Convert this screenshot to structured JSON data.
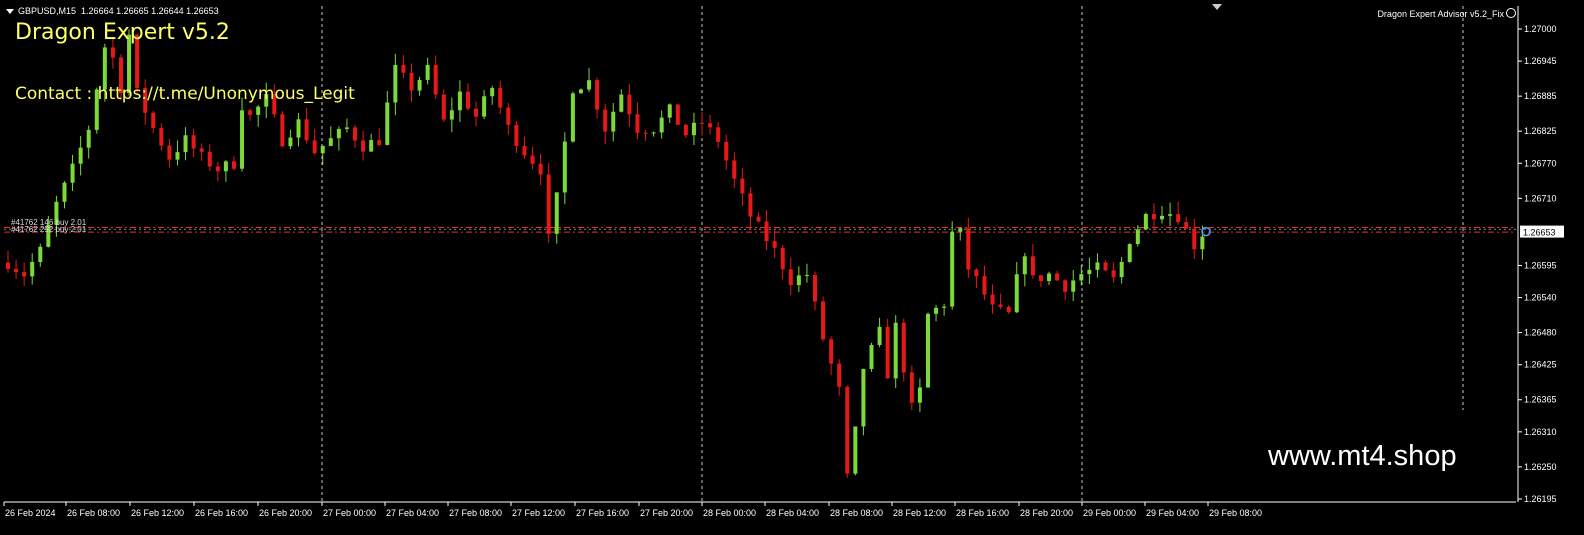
{
  "symbol_info": {
    "symbol": "GBPUSD,M15",
    "ohlc": "1.26664 1.26665 1.26644 1.26653"
  },
  "ea": {
    "title": "Dragon Expert v5.2",
    "contact": "Contact : https://t.me/Unonymous_Legit",
    "label": "Dragon Expert Advisor v5.2_Fix"
  },
  "watermark": "www.mt4.shop",
  "orders": [
    {
      "text": "#41762 146 buy 2.01"
    },
    {
      "text": "#41762 292 buy 2.01"
    }
  ],
  "colors": {
    "background": "#000000",
    "bull_candle": "#7cd93a",
    "bear_candle": "#e81818",
    "grid": "#c8c8c8",
    "price_tag_bg": "#ffffff",
    "order_line": "#e03030",
    "ea_text": "#ffff66"
  },
  "current_price": "1.26653",
  "chart_data": {
    "type": "candlestick",
    "symbol": "GBPUSD",
    "timeframe": "M15",
    "ylim": [
      1.2619,
      1.2703
    ],
    "y_ticks": [
      "1.27000",
      "1.26945",
      "1.26885",
      "1.26825",
      "1.26770",
      "1.26710",
      "1.26653",
      "1.26595",
      "1.26540",
      "1.26480",
      "1.26425",
      "1.26365",
      "1.26310",
      "1.26250",
      "1.26195"
    ],
    "x_ticks": [
      "26 Feb 2024",
      "26 Feb 08:00",
      "26 Feb 12:00",
      "26 Feb 16:00",
      "26 Feb 20:00",
      "27 Feb 00:00",
      "27 Feb 04:00",
      "27 Feb 08:00",
      "27 Feb 12:00",
      "27 Feb 16:00",
      "27 Feb 20:00",
      "28 Feb 00:00",
      "28 Feb 04:00",
      "28 Feb 08:00",
      "28 Feb 12:00",
      "28 Feb 16:00",
      "28 Feb 20:00",
      "29 Feb 00:00",
      "29 Feb 04:00",
      "29 Feb 08:00"
    ],
    "day_separators": [
      "27 Feb 00:00",
      "28 Feb 00:00",
      "29 Feb 00:00"
    ],
    "order_levels": [
      1.2666,
      1.26652
    ],
    "close_path": [
      [
        0,
        1.266
      ],
      [
        2,
        1.2658
      ],
      [
        4,
        1.2662
      ],
      [
        6,
        1.267
      ],
      [
        8,
        1.2676
      ],
      [
        10,
        1.2683
      ],
      [
        12,
        1.2697
      ],
      [
        13,
        1.2695
      ],
      [
        14,
        1.269
      ],
      [
        15,
        1.2699
      ],
      [
        16,
        1.2689
      ],
      [
        18,
        1.2683
      ],
      [
        20,
        1.2678
      ],
      [
        22,
        1.2681
      ],
      [
        24,
        1.2678
      ],
      [
        26,
        1.2676
      ],
      [
        28,
        1.2677
      ],
      [
        29,
        1.2687
      ],
      [
        30,
        1.2685
      ],
      [
        32,
        1.2688
      ],
      [
        34,
        1.2681
      ],
      [
        36,
        1.2684
      ],
      [
        38,
        1.2679
      ],
      [
        40,
        1.2681
      ],
      [
        42,
        1.2683
      ],
      [
        44,
        1.268
      ],
      [
        46,
        1.2681
      ],
      [
        48,
        1.2693
      ],
      [
        50,
        1.269
      ],
      [
        52,
        1.2693
      ],
      [
        54,
        1.2684
      ],
      [
        56,
        1.2689
      ],
      [
        58,
        1.2685
      ],
      [
        60,
        1.269
      ],
      [
        62,
        1.2683
      ],
      [
        64,
        1.2679
      ],
      [
        66,
        1.2676
      ],
      [
        67,
        1.2664
      ],
      [
        68,
        1.2671
      ],
      [
        70,
        1.269
      ],
      [
        72,
        1.2691
      ],
      [
        74,
        1.2683
      ],
      [
        76,
        1.2689
      ],
      [
        78,
        1.2683
      ],
      [
        80,
        1.2683
      ],
      [
        82,
        1.2686
      ],
      [
        84,
        1.2682
      ],
      [
        86,
        1.2684
      ],
      [
        88,
        1.2681
      ],
      [
        90,
        1.2674
      ],
      [
        92,
        1.2668
      ],
      [
        94,
        1.2664
      ],
      [
        95,
        1.2662
      ],
      [
        97,
        1.2657
      ],
      [
        99,
        1.2658
      ],
      [
        101,
        1.2647
      ],
      [
        103,
        1.2638
      ],
      [
        104,
        1.2623
      ],
      [
        105,
        1.2631
      ],
      [
        106,
        1.2642
      ],
      [
        108,
        1.2648
      ],
      [
        109,
        1.2641
      ],
      [
        110,
        1.2649
      ],
      [
        112,
        1.2635
      ],
      [
        113,
        1.2638
      ],
      [
        114,
        1.2651
      ],
      [
        116,
        1.2653
      ],
      [
        117,
        1.2665
      ],
      [
        118,
        1.2665
      ],
      [
        119,
        1.2659
      ],
      [
        120,
        1.2657
      ],
      [
        122,
        1.2652
      ],
      [
        124,
        1.2651
      ],
      [
        125,
        1.2657
      ],
      [
        126,
        1.2662
      ],
      [
        127,
        1.2657
      ],
      [
        129,
        1.2658
      ],
      [
        131,
        1.2656
      ],
      [
        133,
        1.2658
      ],
      [
        135,
        1.2659
      ],
      [
        137,
        1.2657
      ],
      [
        138,
        1.266
      ],
      [
        139,
        1.2664
      ],
      [
        141,
        1.2668
      ],
      [
        143,
        1.2669
      ],
      [
        145,
        1.2668
      ],
      [
        147,
        1.2663
      ],
      [
        148,
        1.2665
      ]
    ]
  }
}
